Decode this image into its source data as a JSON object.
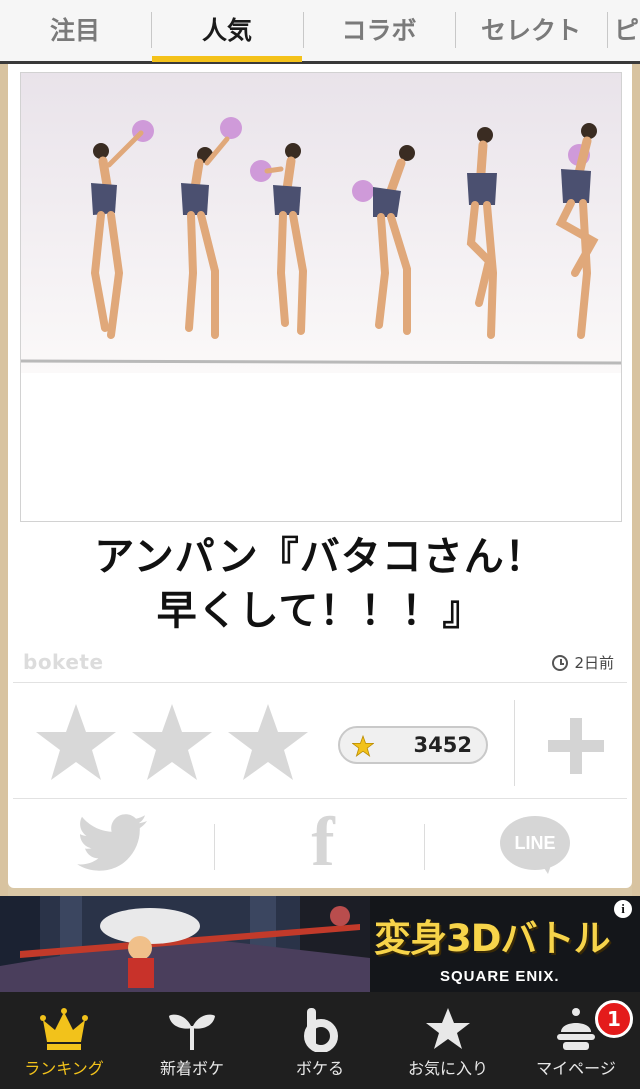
{
  "tabs": [
    "注目",
    "人気",
    "コラボ",
    "セレクト",
    "ピ"
  ],
  "active_tab": "人気",
  "caption": {
    "line1": "アンパン『バタコさん！",
    "line2": "早くして！！！』"
  },
  "logo_text": "bokete",
  "posted_time": "2日前",
  "rating": {
    "stars": 3,
    "filled": 0,
    "count": "3452"
  },
  "share": {
    "facebook_glyph": "f",
    "line_label": "LINE"
  },
  "ad": {
    "title": "変身3Dバトル",
    "maker": "SQUARE ENIX.",
    "info": "i"
  },
  "bottom_nav": [
    {
      "label": "ランキング",
      "icon": "crown-icon"
    },
    {
      "label": "新着ボケ",
      "icon": "sprout-icon"
    },
    {
      "label": "ボケる",
      "icon": "b-logo-icon"
    },
    {
      "label": "お気に入り",
      "icon": "star-icon"
    },
    {
      "label": "マイページ",
      "icon": "user-icon"
    }
  ],
  "notification_badge": "1",
  "colors": {
    "accent": "#f4c21a",
    "nav_bg": "#1f1f1f",
    "badge": "#e41b1b"
  }
}
